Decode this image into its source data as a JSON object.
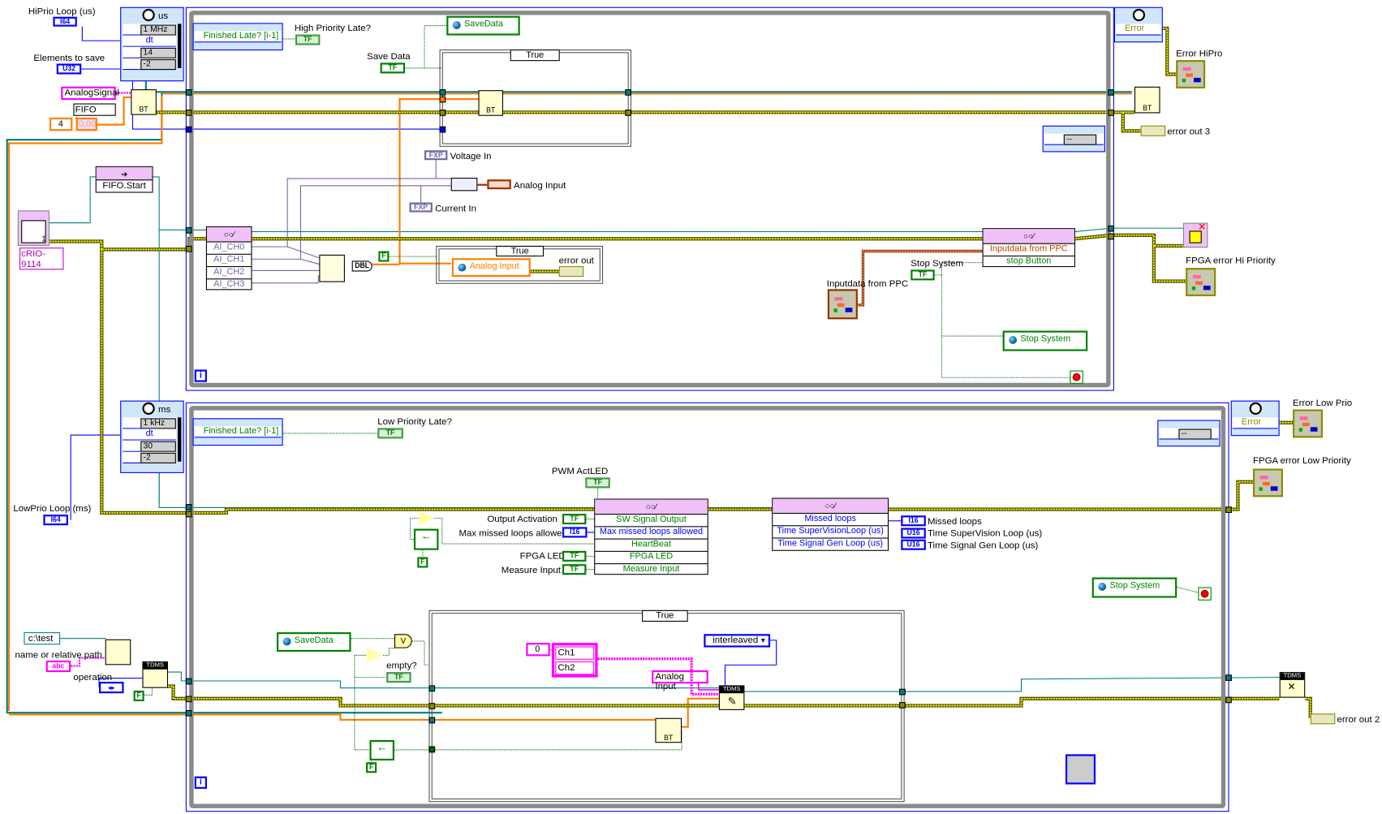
{
  "hi_loop": {
    "unit": "us",
    "period": "1 MHz",
    "dt": "dt",
    "priority": "14",
    "processor": "-2",
    "left_node": "Finished Late? [i-1]",
    "right_node": "Error",
    "iteration": "i"
  },
  "lo_loop": {
    "unit": "ms",
    "period": "1 kHz",
    "dt": "dt",
    "priority": "30",
    "processor": "-2",
    "left_node": "Finished Late? [i-1]",
    "right_node": "Error",
    "iteration": "i"
  },
  "outside": {
    "hiprio_loop_label": "HiPrio Loop (us)",
    "hiprio_type": "I64",
    "elements_label": "Elements to save",
    "elements_type": "U32",
    "analog_signal": "AnalogSignal",
    "fifo_type": "FIFO type",
    "fifo_num": "4",
    "fifo_val": "0,00",
    "fifo_node": "BT",
    "fifo_start": "FIFO.Start",
    "crio": "cRIO-9114",
    "crio_num": "1",
    "lowprio_loop_label": "LowPrio Loop (ms)",
    "lowprio_type": "I64",
    "path_const": "c:\\test",
    "path_label": "name or relative path",
    "abc": "abc",
    "operation_label": "operation",
    "false_const": "F",
    "tdms": "TDMS",
    "error_hipro": "Error HiPro",
    "error_out3": "error out 3",
    "fpga_err_hi": "FPGA error Hi Priority",
    "error_lowprio": "Error Low Prio",
    "fpga_err_low": "FPGA error Low Priority",
    "error_out2": "error out 2",
    "close_bt": "BT"
  },
  "top": {
    "high_priority_late": "High Priority Late?",
    "tf": "TF",
    "savedata_sv": "SaveData",
    "save_data_label": "Save Data",
    "case_selector": "True",
    "bt": "BT",
    "voltage_in": "Voltage In",
    "fxp": "FXP",
    "analog_input": "Analog Input",
    "current_in": "Current In",
    "fpga_rows": [
      "AI_CH0",
      "AI_CH1",
      "AI_CH2",
      "AI_CH3"
    ],
    "dbl": "DBL",
    "false_const": "F",
    "inner_case_selector": "True",
    "analog_input_sv": "Analog Input",
    "error_out": "error out",
    "ppc_rows": [
      "Inputdata from PPC",
      "stop Button"
    ],
    "stop_system_label": "Stop System",
    "inputdata_label": "Inputdata from PPC",
    "stop_system_sv": "Stop System",
    "unbundle_val": "--"
  },
  "bottom": {
    "low_priority_late": "Low Priority Late?",
    "tf": "TF",
    "pwm_label": "PWM ActLED",
    "fpga_rows": [
      "SW Signal Output",
      "Max missed loops allowed",
      "HeartBeat",
      "FPGA LED",
      "Measure Input"
    ],
    "in_labels": [
      "Output  Activation",
      "Max missed loops allowed",
      "FPGA LED",
      "Measure Input"
    ],
    "i16": "I16",
    "u16": "U16",
    "false_const": "F",
    "status_rows": [
      "Missed loops",
      "Time SuperVisionLoop (us)",
      "Time Signal Gen Loop (us)"
    ],
    "status_labels": [
      "Missed loops",
      "Time SuperVision Loop (us)",
      "Time Signal Gen Loop (us)"
    ],
    "stop_system_sv": "Stop System",
    "unbundle_val": "--",
    "savedata_sv": "SaveData",
    "or": "V",
    "empty_label": "empty?",
    "case_selector": "True",
    "index": "0",
    "channels": [
      "Ch1",
      "Ch2"
    ],
    "interleaved": "interleaved",
    "analog_input": "Analog Input",
    "tdms": "TDMS",
    "bt": "BT"
  },
  "colors": {
    "loop_border": "#0000ff",
    "structure": "#8a8a8a",
    "boolean": "#008000",
    "integer": "#0000ff",
    "double": "#ff7f00",
    "string": "#ff00ff",
    "refnum": "#007f7f",
    "error": "#8c8c00",
    "fpga_node": "#f0c0f8"
  }
}
